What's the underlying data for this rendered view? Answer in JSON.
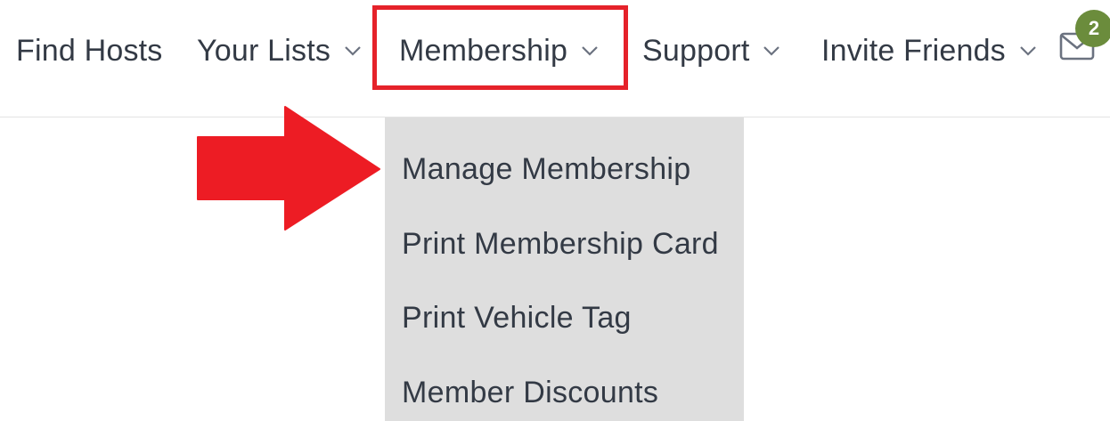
{
  "nav": {
    "items": [
      {
        "label": "Find Hosts",
        "has_dropdown": false
      },
      {
        "label": "Your Lists",
        "has_dropdown": true
      },
      {
        "label": "Membership",
        "has_dropdown": true,
        "highlighted": true
      },
      {
        "label": "Support",
        "has_dropdown": true
      },
      {
        "label": "Invite Friends",
        "has_dropdown": true
      }
    ],
    "messages_icon": "envelope-icon",
    "message_count": "2"
  },
  "dropdown": {
    "items": [
      {
        "label": "Manage Membership"
      },
      {
        "label": "Print Membership Card"
      },
      {
        "label": "Print Vehicle Tag"
      },
      {
        "label": "Member Discounts"
      }
    ]
  },
  "annotation": {
    "highlight_color": "#e5222a",
    "arrow_color": "#ed1c24",
    "arrow_points_to": "Manage Membership"
  },
  "colors": {
    "text": "#333a45",
    "dropdown_bg": "#dedede",
    "badge_bg": "#6b8c3c"
  }
}
